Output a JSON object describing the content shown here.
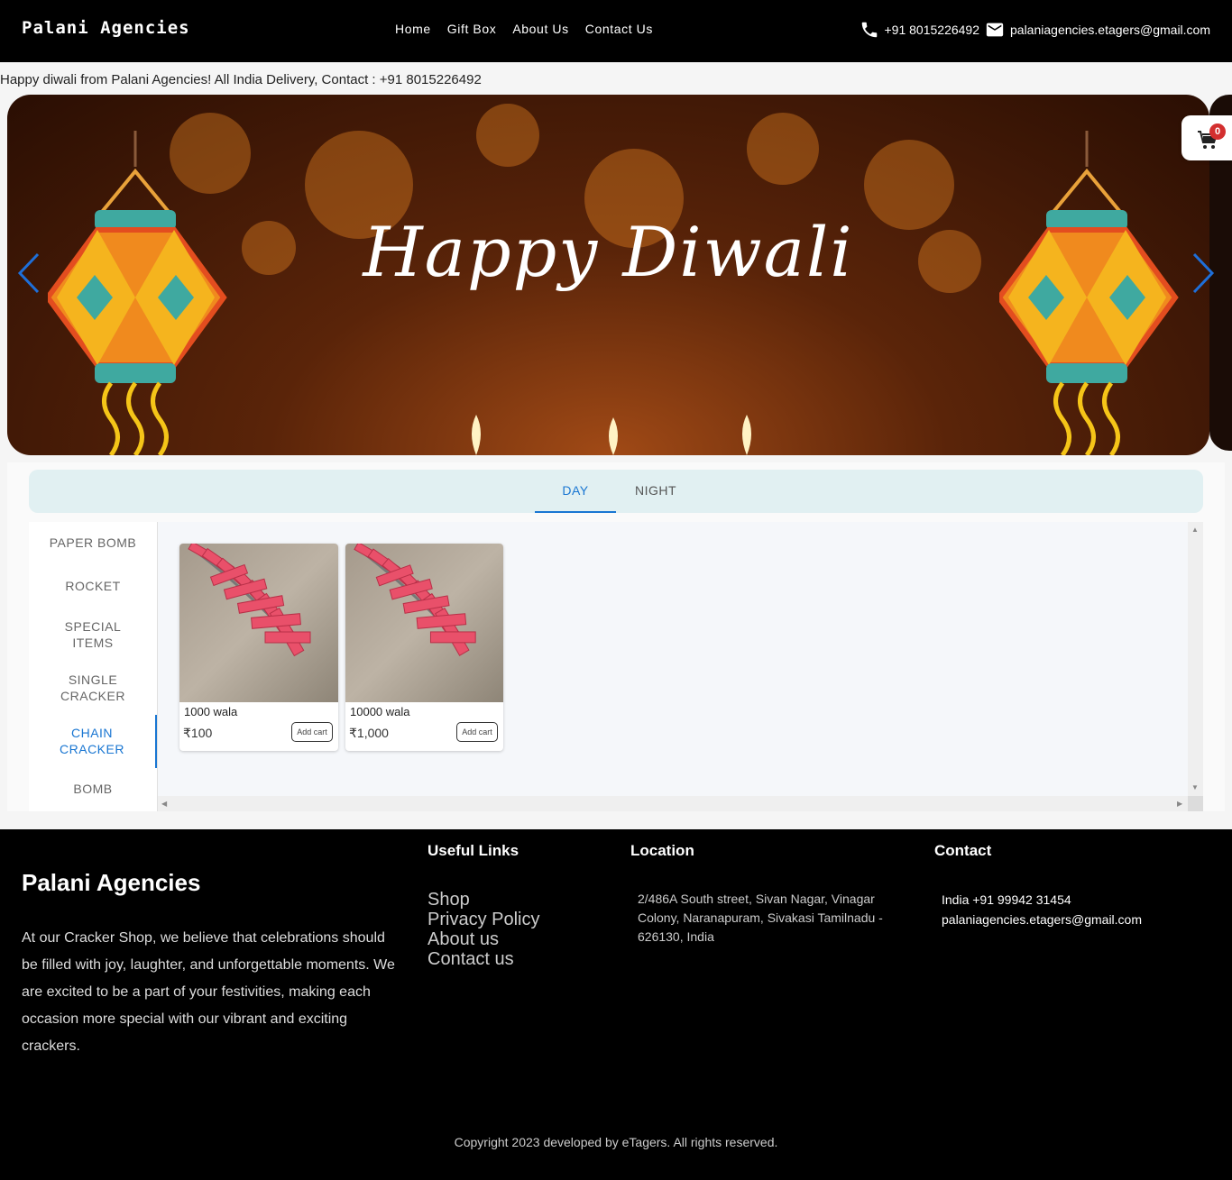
{
  "header": {
    "brand": "Palani Agencies",
    "nav": [
      "Home",
      "Gift Box",
      "About Us",
      "Contact Us"
    ],
    "phone": "+91 8015226492",
    "email": "palaniagencies.etagers@gmail.com"
  },
  "announcement": "Happy diwali from Palani Agencies! All India Delivery, Contact : +91 8015226492",
  "carousel": {
    "slide_text": "Happy Diwali",
    "prev_icon": "chevron-left-icon",
    "next_icon": "chevron-right-icon"
  },
  "cart": {
    "count": "0",
    "icon": "cart-icon",
    "badge_color": "#d32f2f"
  },
  "tabs": [
    {
      "label": "DAY",
      "active": true
    },
    {
      "label": "NIGHT",
      "active": false
    }
  ],
  "categories": [
    {
      "label": "PAPER BOMB",
      "active": false
    },
    {
      "label": "ROCKET",
      "active": false
    },
    {
      "label": "SPECIAL ITEMS",
      "active": false
    },
    {
      "label": "SINGLE CRACKER",
      "active": false
    },
    {
      "label": "CHAIN CRACKER",
      "active": true
    },
    {
      "label": "BOMB",
      "active": false
    }
  ],
  "products": [
    {
      "name": "1000 wala",
      "price": "₹100",
      "button": "Add cart"
    },
    {
      "name": "10000 wala",
      "price": "₹1,000",
      "button": "Add cart"
    }
  ],
  "footer": {
    "brand": "Palani Agencies",
    "about": "At our Cracker Shop, we believe that celebrations should be filled with joy, laughter, and unforgettable moments. We are excited to be a part of your festivities, making each occasion more special with our vibrant and exciting crackers.",
    "useful_links_title": "Useful Links",
    "links": [
      "Shop",
      "Privacy Policy",
      "About us",
      "Contact us"
    ],
    "location_title": "Location",
    "address": "2/486A South street, Sivan Nagar, Vinagar Colony, Naranapuram, Sivakasi Tamilnadu - 626130, India",
    "contact_title": "Contact",
    "contact_phone": "India +91 99942 31454",
    "contact_email": "palaniagencies.etagers@gmail.com",
    "copyright": "Copyright 2023 developed by eTagers. All rights reserved."
  },
  "colors": {
    "accent": "#1976d2",
    "header_bg": "#000000",
    "tabs_bg": "#e1f0f2"
  }
}
